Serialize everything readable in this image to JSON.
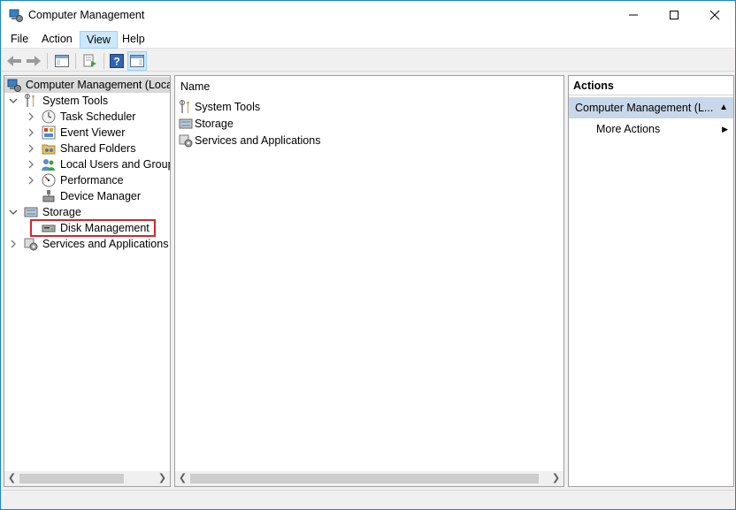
{
  "window": {
    "title": "Computer Management"
  },
  "menubar": {
    "items": [
      "File",
      "Action",
      "View",
      "Help"
    ]
  },
  "tree": {
    "root": "Computer Management (Local",
    "system_tools": "System Tools",
    "task_scheduler": "Task Scheduler",
    "event_viewer": "Event Viewer",
    "shared_folders": "Shared Folders",
    "local_users": "Local Users and Groups",
    "performance": "Performance",
    "device_manager": "Device Manager",
    "storage": "Storage",
    "disk_management": "Disk Management",
    "services_apps": "Services and Applications"
  },
  "list": {
    "column_name": "Name",
    "items": [
      "System Tools",
      "Storage",
      "Services and Applications"
    ]
  },
  "actions": {
    "title": "Actions",
    "group": "Computer Management (L...",
    "more_actions": "More Actions"
  },
  "colors": {
    "highlight_box": "#d6252b",
    "selection": "#c8d8ea",
    "window_border": "#1883d7"
  }
}
